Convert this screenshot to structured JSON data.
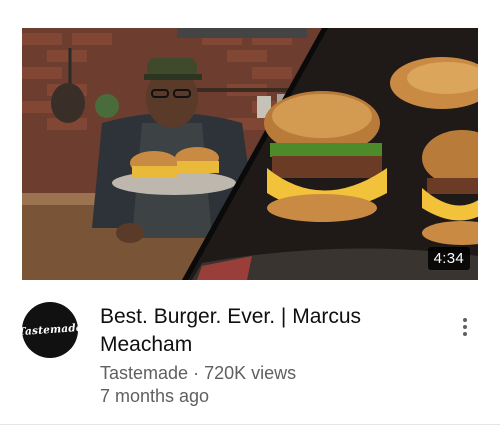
{
  "video": {
    "duration": "4:34",
    "title": "Best. Burger. Ever. | Marcus Meacham",
    "channel": "Tastemade",
    "separator": " · ",
    "views": "720K views",
    "age": "7 months ago"
  },
  "channel_avatar": {
    "logo_text": "Tastemade",
    "icon": "tastemade-logo-icon"
  },
  "menu": {
    "icon": "more-vert-icon"
  },
  "colors": {
    "title": "#0f0f0f",
    "meta": "#606060",
    "avatar_bg": "#111111",
    "duration_bg": "#000000"
  }
}
